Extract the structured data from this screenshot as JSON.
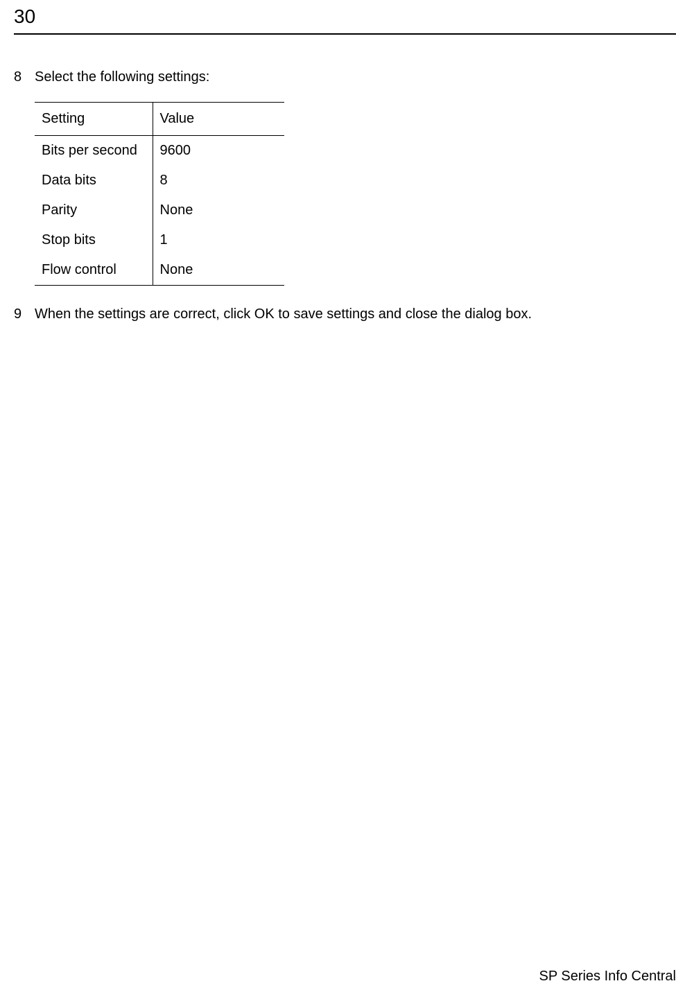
{
  "page_number": "30",
  "steps": [
    {
      "num": "8",
      "text": "Select the following settings:"
    },
    {
      "num": "9",
      "text": "When the settings are correct, click OK to save settings and close the dialog box."
    }
  ],
  "table": {
    "header": {
      "setting": "Setting",
      "value": "Value"
    },
    "rows": [
      {
        "setting": "Bits per second",
        "value": "9600"
      },
      {
        "setting": "Data bits",
        "value": "8"
      },
      {
        "setting": "Parity",
        "value": "None"
      },
      {
        "setting": "Stop bits",
        "value": "1"
      },
      {
        "setting": "Flow control",
        "value": "None"
      }
    ]
  },
  "footer": "SP Series Info Central"
}
